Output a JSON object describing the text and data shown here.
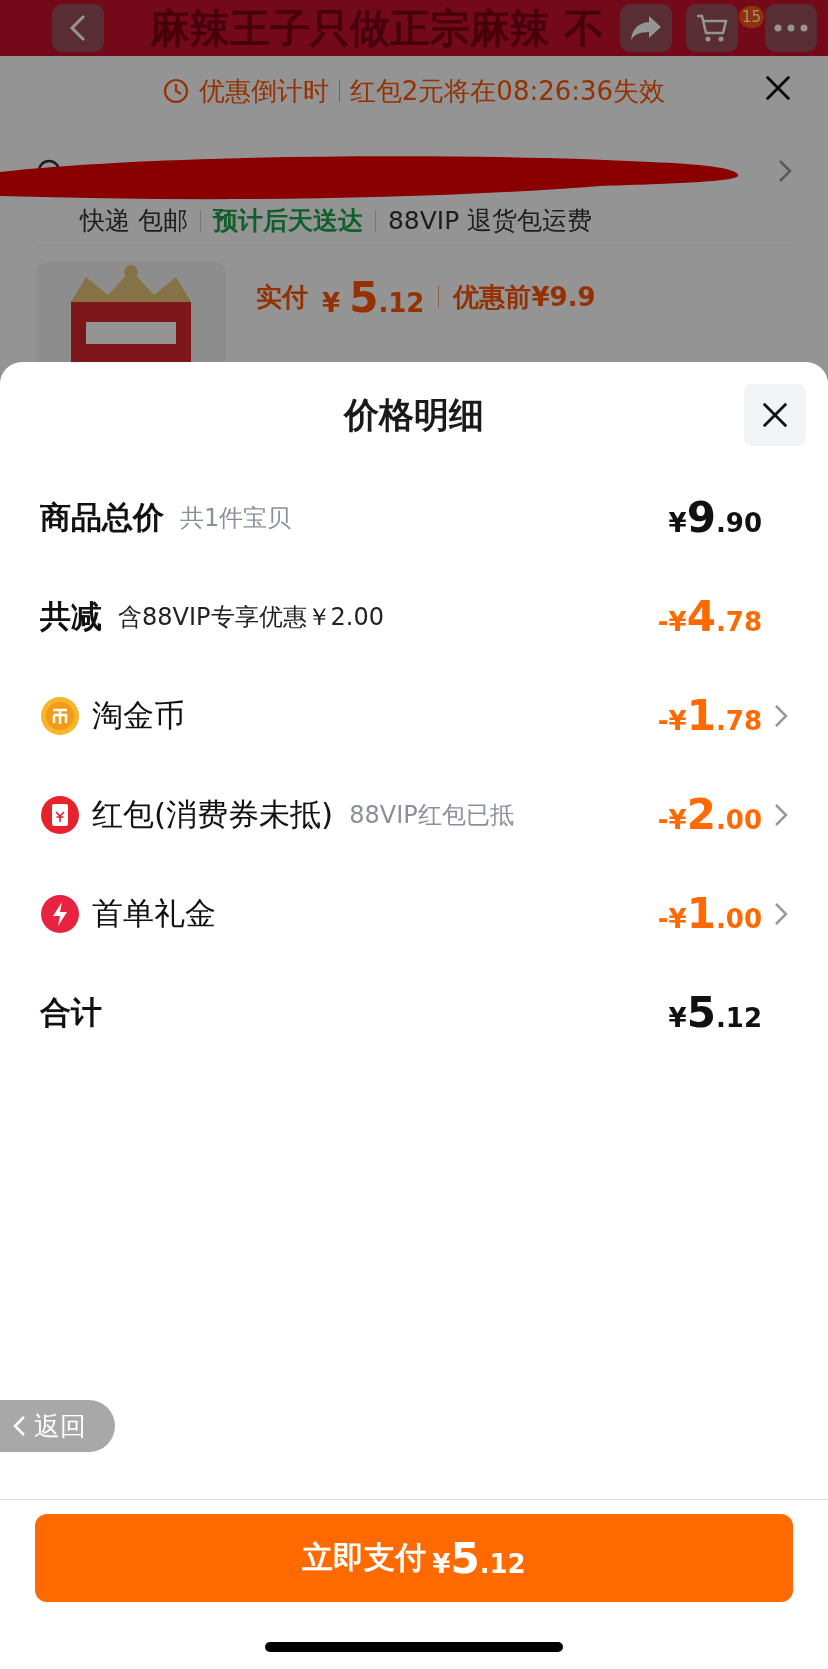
{
  "background": {
    "product_title": "麻辣王子只做正宗麻辣 不",
    "cart_badge": "15",
    "countdown": {
      "label": "优惠倒计时",
      "message": "红包2元将在08:26:36失效"
    },
    "delivery": [
      {
        "text": "快递 包邮",
        "highlight": false
      },
      {
        "text": "预计后天送达",
        "highlight": true
      },
      {
        "text": "88VIP 退货包运费",
        "highlight": false
      }
    ],
    "product": {
      "paid_label": "实付",
      "price": {
        "prefix": "¥ ",
        "main": "5",
        "fraction": ".12"
      },
      "original": "优惠前¥9.9"
    }
  },
  "sheet": {
    "title": "价格明细",
    "rows": [
      {
        "kind": "sum",
        "label": "商品总价",
        "note": "共1件宝贝",
        "price": {
          "prefix": "¥",
          "main": "9",
          "fraction": ".90"
        }
      },
      {
        "kind": "deduction",
        "label": "共减",
        "note": "含88VIP专享优惠￥2.00",
        "price": {
          "prefix": "-¥",
          "main": "4",
          "fraction": ".78"
        }
      },
      {
        "kind": "item",
        "label": "淘金币",
        "price": {
          "prefix": "-¥",
          "main": "1",
          "fraction": ".78"
        }
      },
      {
        "kind": "item",
        "label": "红包(消费券未抵)",
        "note": "88VIP红包已抵",
        "price": {
          "prefix": "-¥",
          "main": "2",
          "fraction": ".00"
        }
      },
      {
        "kind": "item",
        "label": "首单礼金",
        "price": {
          "prefix": "-¥",
          "main": "1",
          "fraction": ".00"
        }
      },
      {
        "kind": "sum",
        "label": "合计",
        "price": {
          "prefix": "¥",
          "main": "5",
          "fraction": ".12"
        }
      }
    ],
    "back": "返回",
    "pay": {
      "label": "立即支付",
      "price": {
        "prefix": "¥",
        "main": "5",
        "fraction": ".12"
      }
    }
  }
}
